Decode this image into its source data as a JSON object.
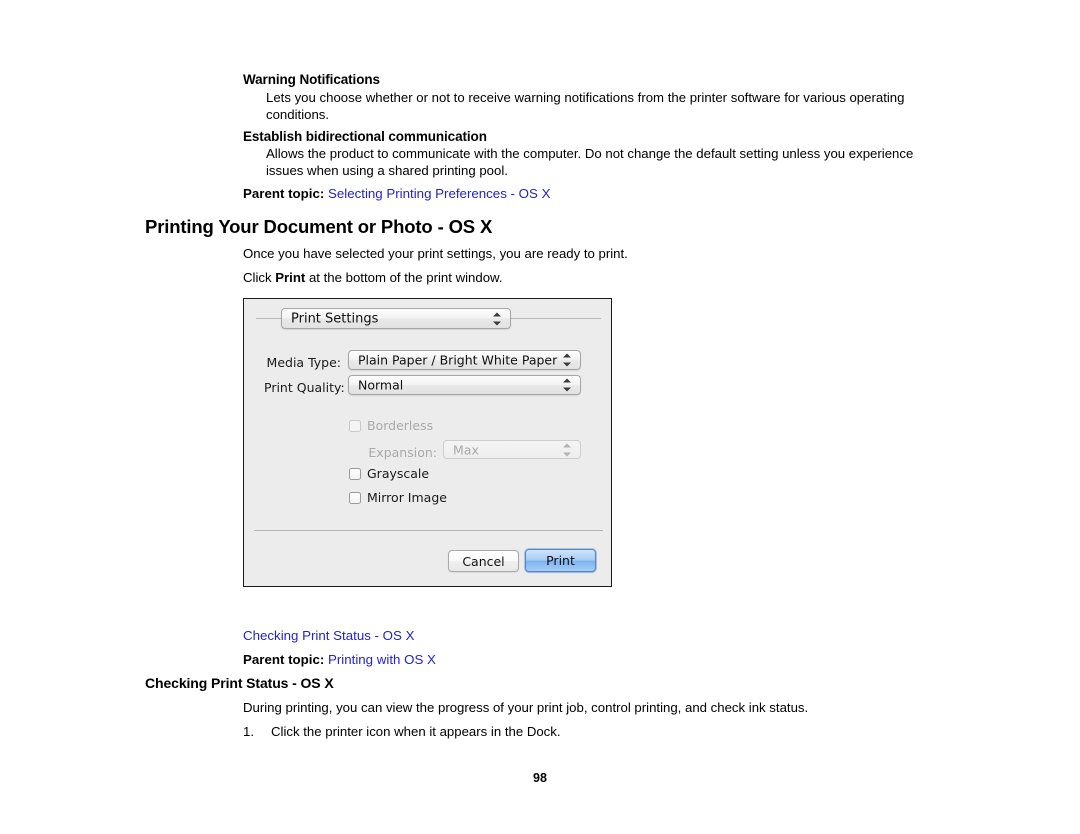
{
  "document": {
    "page_number": "98",
    "link_color": "#2323CC",
    "terms": [
      {
        "title": "Warning Notifications",
        "description": "Lets you choose whether or not to receive warning notifications from the printer software for various operating conditions."
      },
      {
        "title": "Establish bidirectional communication",
        "description": "Allows the product to communicate with the computer. Do not change the default setting unless you experience issues when using a shared printing pool."
      }
    ],
    "parent_topic_1": {
      "label": "Parent topic:",
      "link": "Selecting Printing Preferences - OS X"
    },
    "section_heading": "Printing Your Document or Photo - OS X",
    "intro_paragraph": "Once you have selected your print settings, you are ready to print.",
    "instruction_line": {
      "before": "Click ",
      "bold": "Print",
      "after": " at the bottom of the print window."
    },
    "related_link": "Checking Print Status - OS X",
    "parent_topic_2": {
      "label": "Parent topic:",
      "link": "Printing with OS X"
    },
    "sub_heading": "Checking Print Status - OS X",
    "sub_paragraph": "During printing, you can view the progress of your print job, control printing, and check ink status.",
    "steps": [
      {
        "number": "1.",
        "text": "Click the printer icon when it appears in the Dock."
      }
    ]
  },
  "print_dialog": {
    "pane_popup": {
      "value": "Print Settings"
    },
    "media_type": {
      "label": "Media Type:",
      "value": "Plain Paper / Bright White Paper"
    },
    "print_quality": {
      "label": "Print Quality:",
      "value": "Normal"
    },
    "borderless": {
      "label": "Borderless",
      "checked": false,
      "enabled": false
    },
    "expansion": {
      "label": "Expansion:",
      "value": "Max",
      "enabled": false
    },
    "grayscale": {
      "label": "Grayscale",
      "checked": false,
      "enabled": true
    },
    "mirror_image": {
      "label": "Mirror Image",
      "checked": false,
      "enabled": true
    },
    "buttons": {
      "cancel": "Cancel",
      "print": "Print"
    }
  }
}
